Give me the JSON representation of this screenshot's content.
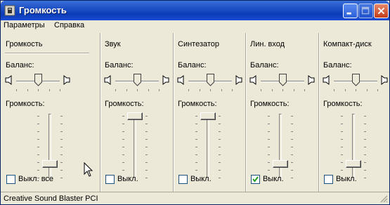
{
  "window": {
    "title": "Громкость",
    "title_icon": "speaker-icon"
  },
  "titlebar_buttons": [
    "minimize",
    "maximize",
    "close"
  ],
  "menu": {
    "items": [
      "Параметры",
      "Справка"
    ]
  },
  "labels": {
    "balance": "Баланс:",
    "volume": "Громкость:"
  },
  "columns": [
    {
      "name": "Громкость",
      "mute_label": "Выкл. все",
      "muted": false,
      "volume_level": 0.2,
      "balance": 0.5
    },
    {
      "name": "Звук",
      "mute_label": "Выкл.",
      "muted": false,
      "volume_level": 1.0,
      "balance": 0.5
    },
    {
      "name": "Синтезатор",
      "mute_label": "Выкл.",
      "muted": false,
      "volume_level": 1.0,
      "balance": 0.5
    },
    {
      "name": "Лин. вход",
      "mute_label": "Выкл.",
      "muted": true,
      "volume_level": 0.2,
      "balance": 0.5
    },
    {
      "name": "Компакт-диск",
      "mute_label": "Выкл.",
      "muted": false,
      "volume_level": 0.2,
      "balance": 0.5
    }
  ],
  "status": {
    "text": "Creative Sound Blaster PCI"
  },
  "colors": {
    "titlebar": "#0b3cb8",
    "face": "#ece9d8",
    "checkbox_border": "#1c5180",
    "check_mark": "#21a121"
  }
}
